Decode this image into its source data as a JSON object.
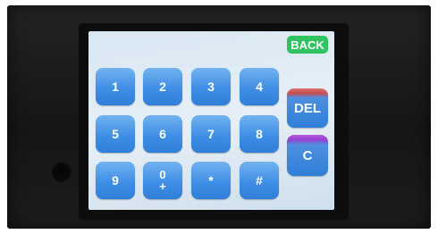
{
  "keypad": {
    "row1": [
      "1",
      "2",
      "3",
      "4"
    ],
    "row2": [
      "5",
      "6",
      "7",
      "8"
    ],
    "row3": {
      "k9": "9",
      "k0_top": "0",
      "k0_bottom": "+",
      "star": "*",
      "hash": "#"
    }
  },
  "actions": {
    "back": "BACK",
    "delete": "DEL",
    "clear": "C"
  },
  "colors": {
    "key_blue": "#3f8ee6",
    "back_green": "#2fc460",
    "screen_bg": "#dfeaf3",
    "enclosure": "#1b1b1b"
  }
}
